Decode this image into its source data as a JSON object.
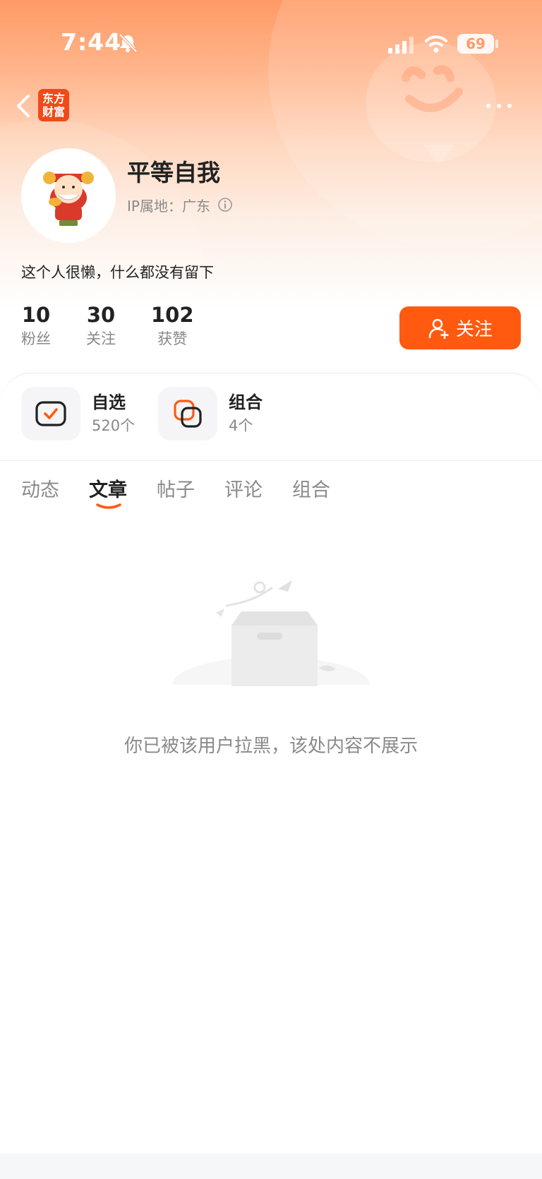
{
  "status_bar": {
    "time": "7:44",
    "battery": "69"
  },
  "header": {
    "logo_text_line1": "东方",
    "logo_text_line2": "财富"
  },
  "profile": {
    "username": "平等自我",
    "ip_location": "IP属地：广东",
    "bio": "这个人很懒，什么都没有留下"
  },
  "stats": [
    {
      "value": "10",
      "label": "粉丝"
    },
    {
      "value": "30",
      "label": "关注"
    },
    {
      "value": "102",
      "label": "获赞"
    }
  ],
  "follow_button": {
    "label": "关注"
  },
  "quick_links": [
    {
      "title": "自选",
      "subtitle": "520个"
    },
    {
      "title": "组合",
      "subtitle": "4个"
    }
  ],
  "tabs": [
    {
      "label": "动态"
    },
    {
      "label": "文章",
      "active": true
    },
    {
      "label": "帖子"
    },
    {
      "label": "评论"
    },
    {
      "label": "组合"
    }
  ],
  "empty_state": {
    "message": "你已被该用户拉黑，该处内容不展示"
  },
  "colors": {
    "accent": "#ff5a0f",
    "logo": "#f04a1a"
  }
}
